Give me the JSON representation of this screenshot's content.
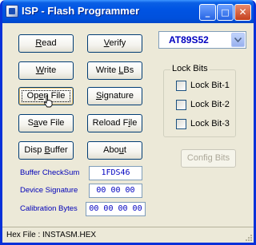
{
  "window": {
    "title": "ISP - Flash Programmer",
    "minimize_symbol": "_",
    "maximize_symbol": "□",
    "close_symbol": "✕"
  },
  "buttons": {
    "read": {
      "pre": "",
      "accel": "R",
      "post": "ead"
    },
    "verify": {
      "pre": "",
      "accel": "V",
      "post": "erify"
    },
    "write": {
      "pre": "",
      "accel": "W",
      "post": "rite"
    },
    "write_lbs": {
      "pre": "Write ",
      "accel": "L",
      "post": "Bs"
    },
    "open_file": {
      "pre": "Op",
      "accel": "e",
      "post": "n File"
    },
    "signature": {
      "pre": "",
      "accel": "S",
      "post": "ignature"
    },
    "save_file": {
      "pre": "S",
      "accel": "a",
      "post": "ve File"
    },
    "reload_file": {
      "pre": "Reload F",
      "accel": "i",
      "post": "le"
    },
    "disp_buffer": {
      "pre": "Disp ",
      "accel": "B",
      "post": "uffer"
    },
    "about": {
      "pre": "Abo",
      "accel": "u",
      "post": "t"
    },
    "config_bits": "Config Bits"
  },
  "device": {
    "selected": "AT89S52"
  },
  "lock_bits": {
    "label": "Lock Bits",
    "items": [
      {
        "label": "Lock Bit-1"
      },
      {
        "label": "Lock Bit-2"
      },
      {
        "label": "Lock Bit-3"
      }
    ]
  },
  "info": {
    "buffer_checksum_label": "Buffer CheckSum",
    "buffer_checksum_value": "1FDS46",
    "device_signature_label": "Device Signature",
    "device_signature_value": "00 00 00",
    "calibration_label": "Calibration Bytes",
    "calibration_value": "00 00 00 00"
  },
  "status": {
    "hex_file": "Hex File :  INSTASM.HEX"
  },
  "colors": {
    "titlebar": "#0054e3",
    "window_bg": "#ece9d8",
    "label_blue": "#0000b8"
  }
}
